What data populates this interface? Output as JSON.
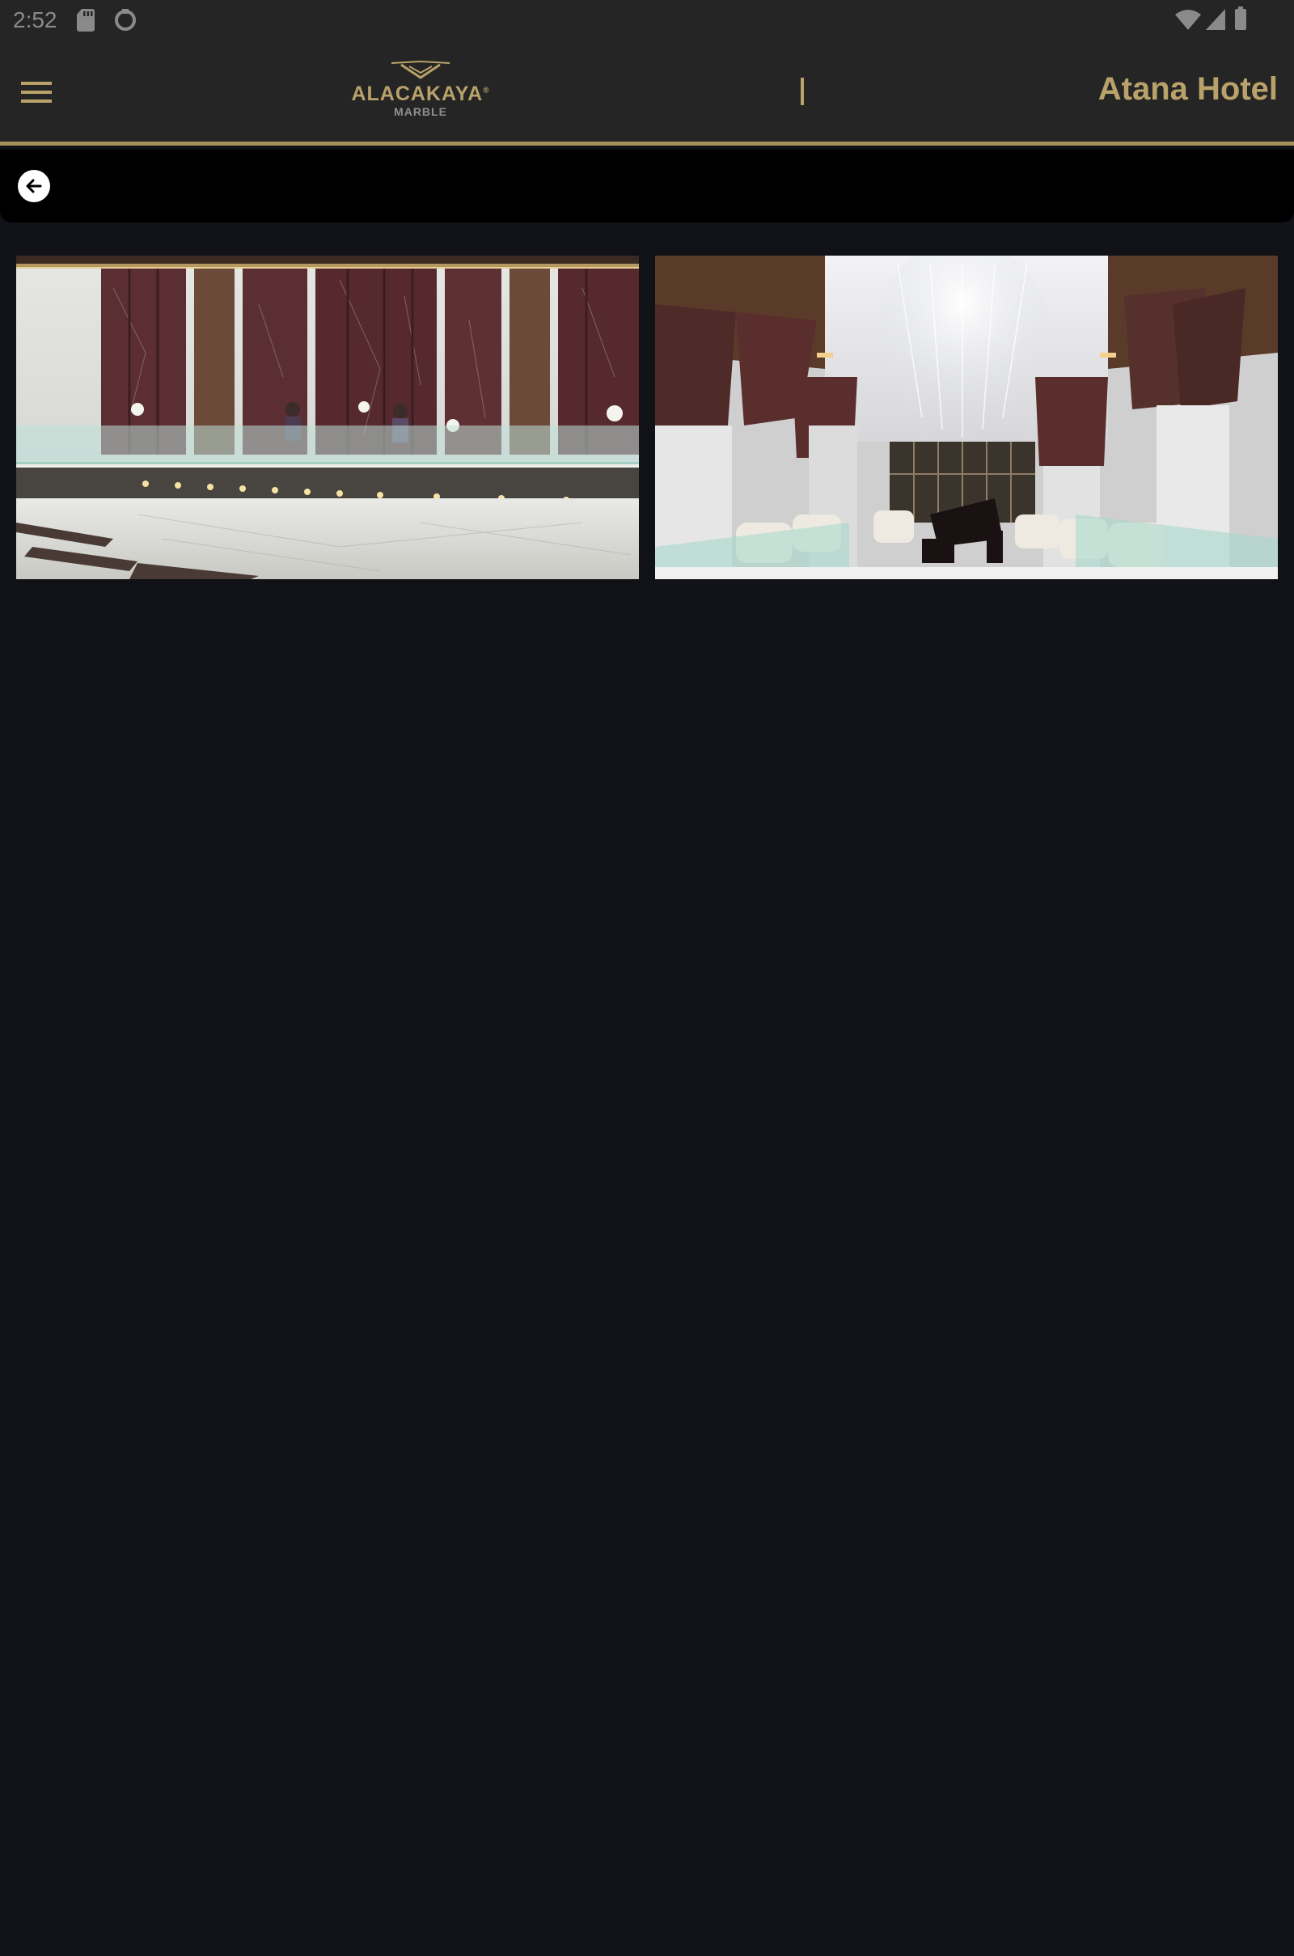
{
  "status_bar": {
    "time": "2:52",
    "left_icons": [
      "sd-card-icon",
      "sync-icon"
    ],
    "right_icons": [
      "wifi-icon",
      "signal-icon",
      "battery-icon"
    ]
  },
  "header": {
    "menu_icon": "hamburger-menu-icon",
    "logo": {
      "name": "ALACAKAYA",
      "registered": "®",
      "subtitle": "MARBLE"
    },
    "title": "Atana Hotel",
    "accent_color": "#b9a26a"
  },
  "back_bar": {
    "icon": "arrow-left-icon"
  },
  "gallery": {
    "photos": [
      {
        "subject": "hotel-lobby-reception-desk"
      },
      {
        "subject": "hotel-lounge-with-piano"
      }
    ]
  },
  "colors": {
    "background": "#111217",
    "header_background": "#252525",
    "accent": "#b9a26a",
    "back_bar_background": "#000000"
  }
}
